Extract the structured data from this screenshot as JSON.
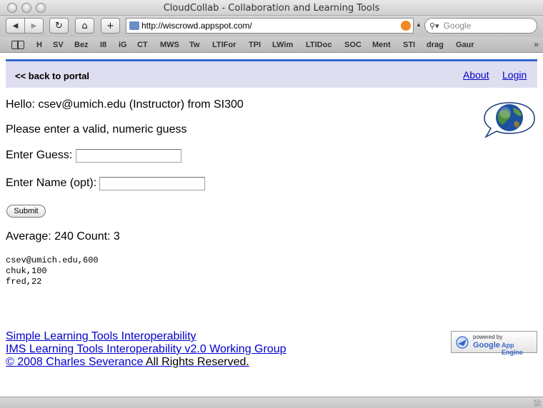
{
  "window": {
    "title": "CloudCollab - Collaboration and Learning Tools"
  },
  "toolbar": {
    "back_icon": "back-arrow-icon",
    "forward_icon": "forward-arrow-icon",
    "reload_icon": "reload-icon",
    "home_icon": "home-icon",
    "add_icon": "plus-icon",
    "url": "http://wiscrowd.appspot.com/",
    "search_placeholder": "Google"
  },
  "bookmarks": [
    "H",
    "SV",
    "Bez",
    "I8",
    "iG",
    "CT",
    "MWS",
    "Tw",
    "LTIFor",
    "TPI",
    "LWim",
    "LTIDoc",
    "SOC",
    "Ment",
    "STI",
    "drag",
    "Gaur"
  ],
  "portal": {
    "back_link": "<< back to portal",
    "about": "About",
    "login": "Login"
  },
  "main": {
    "greeting": "Hello: csev@umich.edu (Instructor) from SI300",
    "message": "Please enter a valid, numeric guess",
    "guess_label": "Enter Guess:",
    "guess_value": "",
    "name_label": "Enter Name (opt):",
    "name_value": "",
    "submit": "Submit",
    "stats": "Average: 240 Count: 3",
    "guesses": [
      "csev@umich.edu,600",
      "chuk,100",
      "fred,22"
    ]
  },
  "footer": {
    "link1": "Simple Learning Tools Interoperability",
    "link2": "IMS Learning Tools Interoperability v2.0 Working Group",
    "copyright_link": "© 2008 Charles Severance",
    "rights": " All Rights Reserved.",
    "badge_powered": "powered by",
    "badge_google": "Google",
    "badge_ae": "App Engine"
  },
  "colors": {
    "accent": "#3366cc",
    "portal_bg": "#dedef0",
    "link": "#0000cc"
  }
}
